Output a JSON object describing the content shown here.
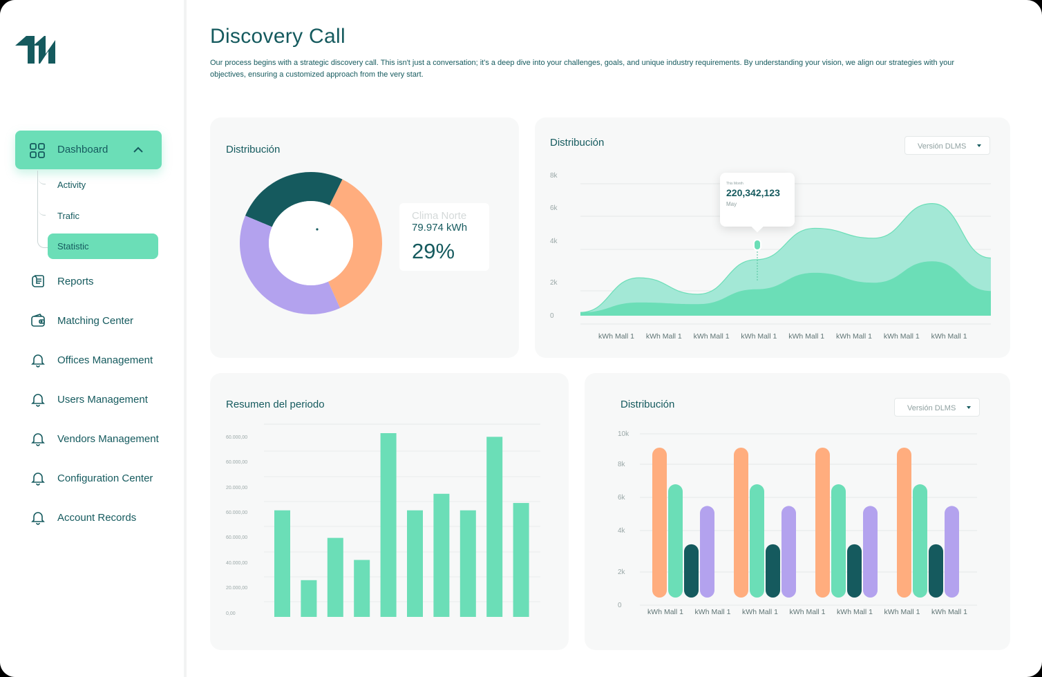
{
  "sidebar": {
    "active": {
      "label": "Dashboard"
    },
    "sub_items": [
      "Activity",
      "Trafic",
      "Statistic"
    ],
    "items": [
      {
        "label": "Reports",
        "icon": "reports-icon"
      },
      {
        "label": "Matching Center",
        "icon": "wallet-icon"
      },
      {
        "label": "Offices Management",
        "icon": "bell-icon"
      },
      {
        "label": "Users Management",
        "icon": "bell-icon"
      },
      {
        "label": "Vendors Management",
        "icon": "bell-icon"
      },
      {
        "label": "Configuration Center",
        "icon": "bell-icon"
      },
      {
        "label": "Account Records",
        "icon": "bell-icon"
      }
    ]
  },
  "header": {
    "title": "Discovery Call",
    "description": "Our process begins with a strategic discovery call. This isn't just a conversation; it's a deep dive into your challenges, goals, and unique industry requirements. By understanding your vision, we align our strategies with your objectives, ensuring a customized approach from the very start."
  },
  "colors": {
    "teal_dark": "#155a5e",
    "mint": "#6bdeb7",
    "mint_light": "#a3e8d6",
    "orange": "#ffad7e",
    "purple": "#b3a2ee"
  },
  "cards": {
    "donut": {
      "title": "Distribución",
      "legend_name": "Clima Norte",
      "legend_value": "79.974 kWh",
      "legend_pct": "29%"
    },
    "area": {
      "title": "Distribución",
      "dropdown": "Versión DLMS",
      "tooltip_label": "This Month",
      "tooltip_value": "220,342,123",
      "tooltip_month": "May"
    },
    "bars": {
      "title": "Resumen del periodo"
    },
    "grouped": {
      "title": "Distribución",
      "dropdown": "Versión DLMS"
    }
  },
  "chart_data": [
    {
      "type": "pie",
      "title": "Distribución",
      "slices": [
        {
          "name": "teal",
          "value": 26,
          "color": "#155a5e"
        },
        {
          "name": "orange",
          "value": 36,
          "color": "#ffad7e"
        },
        {
          "name": "purple",
          "value": 38,
          "color": "#b3a2ee"
        }
      ]
    },
    {
      "type": "area",
      "title": "Distribución",
      "yticks": [
        "8k",
        "6k",
        "4k",
        "2k",
        "0"
      ],
      "ylim": [
        0,
        8000
      ],
      "categories": [
        "kWh Mall 1",
        "kWh Mall 1",
        "kWh Mall 1",
        "kWh Mall 1",
        "kWh Mall 1",
        "kWh Mall 1",
        "kWh Mall 1",
        "kWh Mall 1"
      ],
      "series": [
        {
          "values": [
            200,
            2300,
            1300,
            3400,
            5300,
            4700,
            6800,
            3500
          ]
        },
        {
          "values": [
            200,
            800,
            700,
            1600,
            2600,
            2000,
            3300,
            1500
          ]
        }
      ]
    },
    {
      "type": "bar",
      "title": "Resumen del periodo",
      "yticks": [
        "60.000,00",
        "60.000,00",
        "20.000,00",
        "60.000,00",
        "60.000,00",
        "40.000,00",
        "20.000,00",
        "0,00"
      ],
      "values": [
        0.58,
        0.2,
        0.43,
        0.31,
        1.0,
        0.58,
        0.67,
        0.58,
        0.98,
        0.62
      ]
    },
    {
      "type": "bar",
      "title": "Distribución",
      "yticks": [
        "10k",
        "8k",
        "6k",
        "4k",
        "2k",
        "0"
      ],
      "ylim": [
        0,
        10000
      ],
      "categories": [
        "kWh Mall 1",
        "kWh Mall 1",
        "kWh Mall 1",
        "kWh Mall 1",
        "kWh Mall 1",
        "kWh Mall 1",
        "kWh Mall 1"
      ],
      "groups": 4,
      "series": [
        {
          "color": "#ffad7e",
          "values": [
            9000,
            9000,
            9000,
            9000
          ]
        },
        {
          "color": "#6bdeb7",
          "values": [
            6800,
            6800,
            6800,
            6800
          ]
        },
        {
          "color": "#155a5e",
          "values": [
            3200,
            3200,
            3200,
            3200
          ]
        },
        {
          "color": "#b3a2ee",
          "values": [
            5500,
            5500,
            5500,
            5500
          ]
        }
      ]
    }
  ]
}
